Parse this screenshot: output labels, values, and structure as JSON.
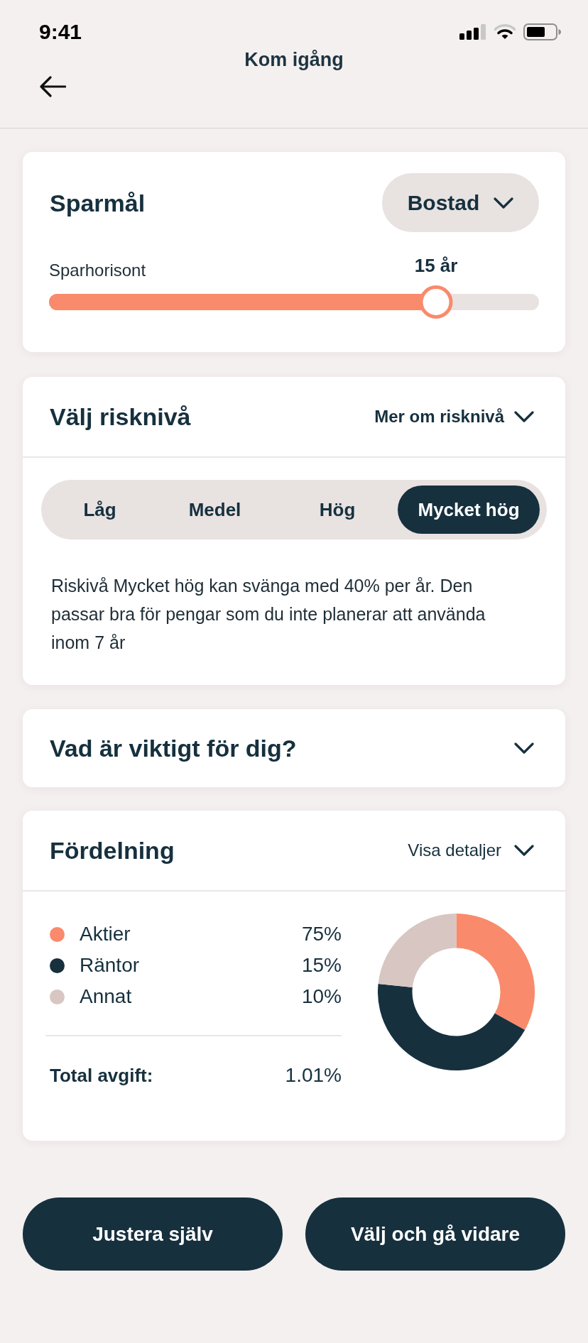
{
  "status_bar": {
    "time": "9:41"
  },
  "header": {
    "title": "Kom igång"
  },
  "savings_goal": {
    "title": "Sparmål",
    "goal_dropdown": {
      "value": "Bostad"
    },
    "horizon": {
      "label": "Sparhorisont",
      "reading": "15 år",
      "level": 0.79
    }
  },
  "risk_level": {
    "title": "Välj risknivå",
    "more_link": "Mer om risknivå",
    "options": [
      {
        "label": "Låg",
        "selected": false
      },
      {
        "label": "Medel",
        "selected": false
      },
      {
        "label": "Hög",
        "selected": false
      },
      {
        "label": "Mycket hög",
        "selected": true
      }
    ],
    "description": "Riskivå Mycket hög kan svänga med 40% per år. Den passar bra för pengar som du inte planerar att använda inom 7 år"
  },
  "importance": {
    "title": "Vad är viktigt för dig?"
  },
  "allocation": {
    "title": "Fördelning",
    "details_link": "Visa detaljer",
    "items": [
      {
        "name": "Aktier",
        "value": "75%",
        "color": "#f98a6c"
      },
      {
        "name": "Räntor",
        "value": "15%",
        "color": "#16303e"
      },
      {
        "name": "Annat",
        "value": "10%",
        "color": "#d8c6c2"
      }
    ],
    "fee": {
      "label": "Total avgift:",
      "value": "1.01%"
    }
  },
  "actions": [
    {
      "label": "Justera själv"
    },
    {
      "label": "Välj och gå vidare"
    }
  ]
}
